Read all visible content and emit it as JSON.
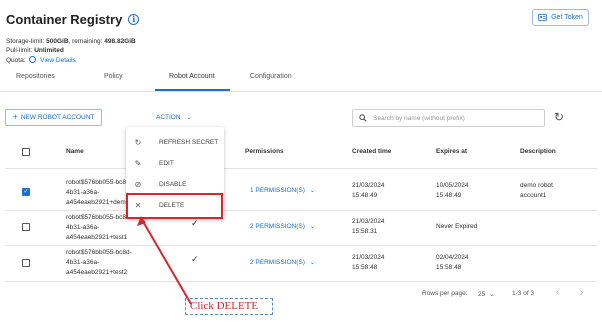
{
  "header": {
    "title": "Container Registry",
    "get_token_label": "Get Token",
    "storage_label": "Storage-limit:",
    "storage_value": "500GiB",
    "remaining_label": ", remaining:",
    "remaining_value": "498.82GiB",
    "pull_label": "Pull-limit:",
    "pull_value": "Unlimited",
    "quota_label": "Quota:",
    "quota_link": "View Details"
  },
  "tabs": [
    "Repositories",
    "Policy",
    "Robot Account",
    "Configuration"
  ],
  "toolbar": {
    "new_label": "NEW ROBOT ACCOUNT",
    "action_label": "ACTION",
    "search_placeholder": "Search by name (without prefix)"
  },
  "table": {
    "headers": [
      "Name",
      "Permissions",
      "Created time",
      "Expires at",
      "Description"
    ],
    "rows": [
      {
        "checked": true,
        "name_lines": [
          "robot$576bb055-bc8",
          "4b31-a36a-",
          "a454eaeb2921+dem"
        ],
        "permissions": "1 PERMISSION(S)",
        "created": [
          "21/03/2024",
          "15:48:49"
        ],
        "expires": [
          "10/05/2024",
          "15:48:49"
        ],
        "description": [
          "demo robot",
          "account1"
        ]
      },
      {
        "checked": false,
        "name_lines": [
          "robot$576bb055-bc8",
          "4b31-a36a-",
          "a454eaeb2921+test1"
        ],
        "permissions": "2 PERMISSION(S)",
        "created": [
          "21/03/2024",
          "15:58:31"
        ],
        "expires": [
          "Never Expired"
        ],
        "description": []
      },
      {
        "checked": false,
        "name_lines": [
          "robot$576bb055-bc8d-",
          "4b31-a36a-",
          "a454eaeb2921+test2"
        ],
        "permissions": "2 PERMISSION(S)",
        "created": [
          "21/03/2024",
          "15:58:48"
        ],
        "expires": [
          "02/04/2024",
          "15:58:48"
        ],
        "description": []
      }
    ]
  },
  "action_menu": {
    "items": [
      {
        "label": "REFRESH SECRET",
        "icon": "refresh-icon"
      },
      {
        "label": "EDIT",
        "icon": "pencil-icon"
      },
      {
        "label": "DISABLE",
        "icon": "disable-icon"
      },
      {
        "label": "DELETE",
        "icon": "close-icon"
      }
    ]
  },
  "pagination": {
    "rows_per_page_label": "Rows per page:",
    "rows_per_page_value": "25",
    "range": "1-3 of 3"
  },
  "annotation": {
    "text": "Click DELETE",
    "color": "#d7262c"
  },
  "colors": {
    "accent": "#1a6fd1",
    "highlight": "#d7262c"
  }
}
